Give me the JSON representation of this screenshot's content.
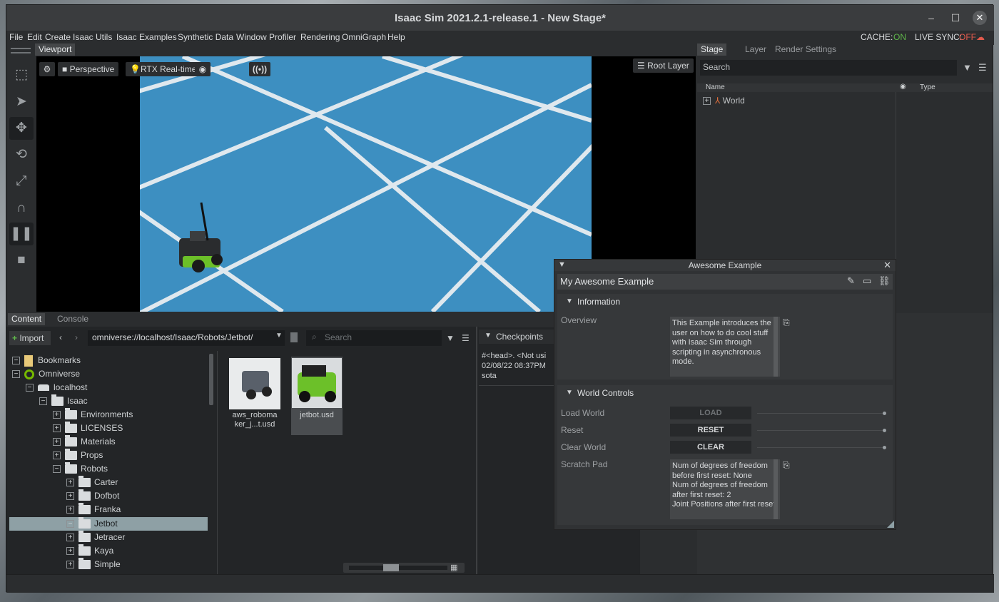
{
  "window": {
    "title": "Isaac Sim 2021.2.1-release.1 - New Stage*"
  },
  "menu": [
    "File",
    "Edit",
    "Create",
    "Isaac Utils",
    "Isaac Examples",
    "Synthetic Data",
    "Window",
    "Profiler",
    "Rendering",
    "OmniGraph",
    "Help"
  ],
  "status": {
    "cache_label": "CACHE:",
    "cache_value": "ON",
    "livesync_label": "LIVE SYNC:",
    "livesync_value": "OFF"
  },
  "viewport": {
    "tab": "Viewport",
    "perspective": "Perspective",
    "renderer": "RTX Real-time",
    "root_layer": "Root Layer"
  },
  "stage": {
    "tabs": [
      "Stage",
      "Layer",
      "Render Settings"
    ],
    "search_placeholder": "Search",
    "col_name": "Name",
    "col_type": "Type",
    "world": "World"
  },
  "content": {
    "tabs": [
      "Content",
      "Console"
    ],
    "import": "Import",
    "path": "omniverse://localhost/Isaac/Robots/Jetbot/",
    "search_placeholder": "Search",
    "tree": {
      "bookmarks": "Bookmarks",
      "omniverse": "Omniverse",
      "localhost": "localhost",
      "isaac": "Isaac",
      "environments": "Environments",
      "licenses": "LICENSES",
      "materials": "Materials",
      "props": "Props",
      "robots": "Robots",
      "carter": "Carter",
      "dofbot": "Dofbot",
      "franka": "Franka",
      "jetbot": "Jetbot",
      "jetracer": "Jetracer",
      "kaya": "Kaya",
      "simple": "Simple"
    },
    "files": [
      {
        "name_line1": "aws_roboma",
        "name_line2": "ker_j...t.usd"
      },
      {
        "name_line1": "jetbot.usd",
        "name_line2": ""
      }
    ]
  },
  "checkpoints": {
    "title": "Checkpoints",
    "line1": "#<head>.   <Not usi",
    "line2": "02/08/22 08:37PM",
    "line3": "sota"
  },
  "awesome": {
    "window_title": "Awesome Example",
    "header": "My Awesome Example",
    "info_title": "Information",
    "overview_label": "Overview",
    "overview_text": "This Example introduces the user on how to do cool stuff with Isaac Sim through scripting in asynchronous mode.",
    "world_controls_title": "World Controls",
    "load_label": "Load World",
    "load_button": "LOAD",
    "reset_label": "Reset",
    "reset_button": "RESET",
    "clear_label": "Clear World",
    "clear_button": "CLEAR",
    "scratch_label": "Scratch Pad",
    "scratch_text": "Num of degrees of freedom before first reset: None\nNum of degrees of freedom after first reset: 2\nJoint Positions after first reset"
  },
  "colors": {
    "on": "#5fb64a",
    "off": "#e25a4c",
    "accent_green": "#76b900"
  }
}
